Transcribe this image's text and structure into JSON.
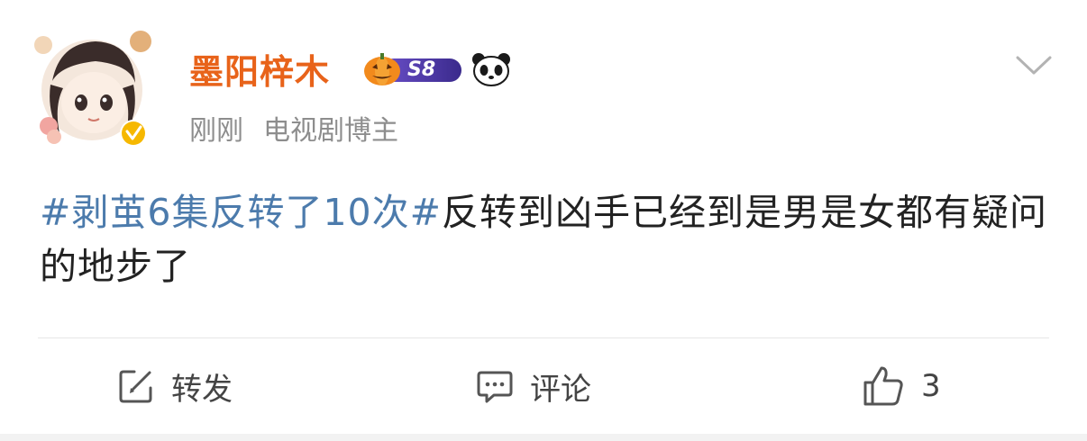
{
  "post": {
    "username": "墨阳梓木",
    "level_badge": "S8",
    "timestamp": "刚刚",
    "role": "电视剧博主",
    "hashtag": "#剥茧6集反转了10次#",
    "body": "反转到凶手已经到是男是女都有疑问的地步了"
  },
  "actions": {
    "repost_label": "转发",
    "comment_label": "评论",
    "like_count": "3"
  },
  "icons": {
    "avatar": "avatar-image",
    "verified": "verified-badge-icon",
    "level": "pumpkin-level-badge-icon",
    "panda": "panda-badge-icon",
    "menu": "chevron-down-icon",
    "repost": "edit-share-icon",
    "comment": "comment-bubble-icon",
    "like": "thumbs-up-icon"
  },
  "colors": {
    "username": "#e8631a",
    "hashtag": "#4c7bac",
    "meta": "#8d8d8d",
    "verified": "#f6b800"
  }
}
